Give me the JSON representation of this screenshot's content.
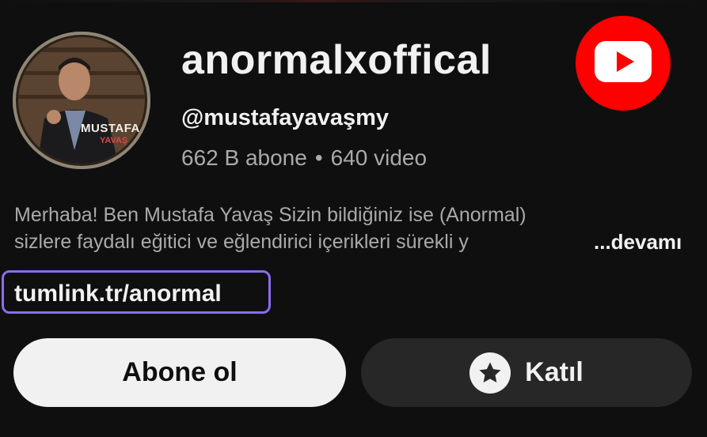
{
  "channel": {
    "name": "anormalxoffical",
    "handle": "@mustafayavaşmy",
    "subscribers": "662 B abone",
    "separator": "•",
    "videos": "640 video",
    "avatar_text_top": "MUSTAFA",
    "avatar_text_bottom": "YAVAŞ"
  },
  "description": {
    "line1": "Merhaba! Ben Mustafa Yavaş Sizin bildiğiniz ise (Anormal)",
    "line2": "sizlere faydalı eğitici ve eğlendirici içerikleri sürekli y",
    "more": "...devamı"
  },
  "link": {
    "text": "tumlink.tr/anormal"
  },
  "buttons": {
    "subscribe": "Abone ol",
    "join": "Katıl"
  },
  "colors": {
    "background": "#0f0f0f",
    "youtube_red": "#ff0000",
    "highlight": "#8a6cf0"
  },
  "icons": {
    "youtube": "youtube-logo-icon",
    "join": "star-icon"
  }
}
